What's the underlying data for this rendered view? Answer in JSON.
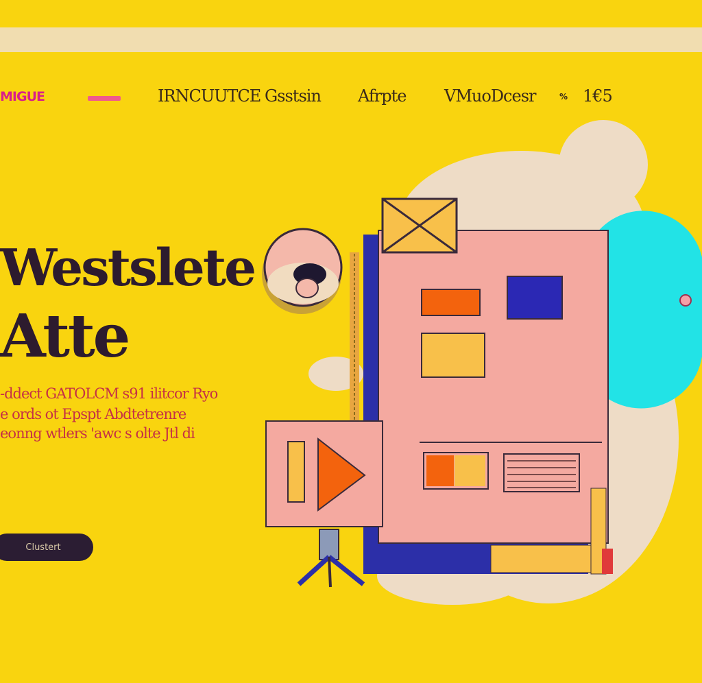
{
  "colors": {
    "background": "#f9d40f",
    "topbar": "#f1ddb0",
    "brand": "#d81f8a",
    "title": "#2d1b2e",
    "subtitle": "#c53046",
    "cta_bg": "#2b1d33"
  },
  "header": {
    "logo_text": "MIGUE",
    "nav": [
      {
        "label": "IRNCUUTCE"
      },
      {
        "label": "Gsstsin"
      },
      {
        "label": "Afrpte"
      },
      {
        "label": "VMuoDcesr"
      }
    ],
    "nav_extra": "%",
    "nav_last": "1€5"
  },
  "hero": {
    "title_line1": "Westslete",
    "title_line2": "Atte",
    "subtitle_lines": [
      "-ddect GATOLCM s91 ilitcor Ryo",
      "e ords ot Epspt Abdtetrenre",
      "eonng wtlers 'awc s olte Jtl di"
    ],
    "cta_label": "Clustert"
  },
  "illustration": {
    "icons": [
      "envelope-icon",
      "play-icon",
      "clock-icon",
      "easel-icon"
    ]
  }
}
